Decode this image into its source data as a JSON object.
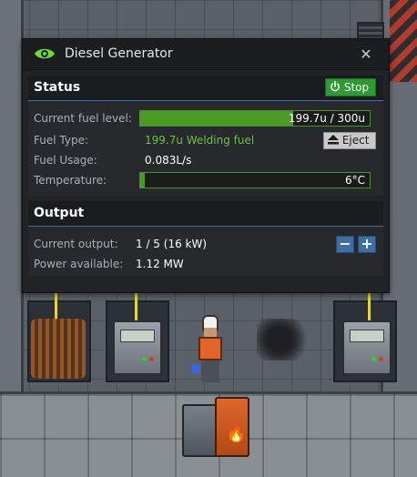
{
  "window": {
    "title": "Diesel Generator",
    "close_glyph": "✕",
    "title_icon": "eye-icon"
  },
  "status": {
    "heading": "Status",
    "stop_label": "Stop",
    "stop_icon": "power-icon",
    "rows": {
      "fuel_level_label": "Current fuel level:",
      "fuel_level_text": "199.7u / 300u",
      "fuel_level_fraction": 0.666,
      "fuel_type_label": "Fuel Type:",
      "fuel_type_value": "199.7u Welding fuel",
      "eject_label": "Eject",
      "eject_icon": "eject-icon",
      "fuel_usage_label": "Fuel Usage:",
      "fuel_usage_value": "0.083L/s",
      "temperature_label": "Temperature:",
      "temperature_text": "6°C",
      "temperature_fraction": 0.02
    }
  },
  "output": {
    "heading": "Output",
    "current_output_label": "Current output:",
    "current_output_value": "1 / 5 (16 kW)",
    "power_available_label": "Power available:",
    "power_available_value": "1.12 MW",
    "minus_label": "−",
    "plus_label": "+"
  },
  "colors": {
    "accent_green": "#4b9a26",
    "stop_button": "#2f9a33",
    "section_rule": "#3d6ea5",
    "green_text": "#6bc23a"
  }
}
